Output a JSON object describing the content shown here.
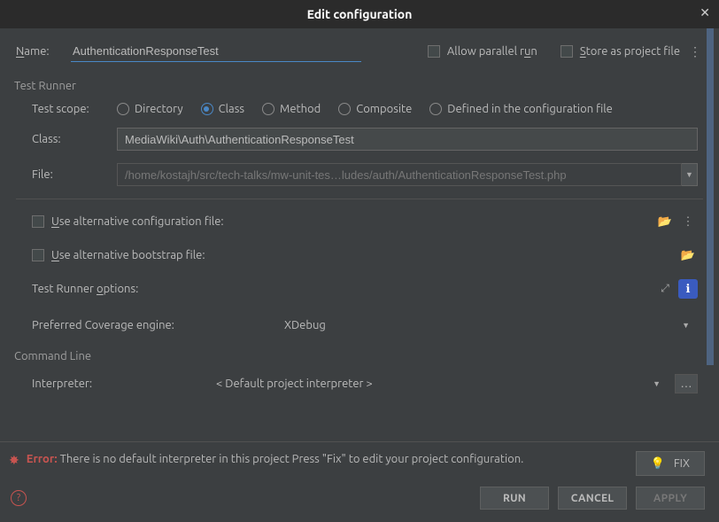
{
  "titlebar": {
    "title": "Edit conﬁguration"
  },
  "name": {
    "label": "Name:",
    "value": "AuthenticationResponseTest"
  },
  "allow_parallel": "Allow parallel run",
  "store_file": "Store as project file",
  "section_runner": "Test Runner",
  "scope": {
    "label": "Test scope:",
    "options": [
      "Directory",
      "Class",
      "Method",
      "Composite",
      "Defined in the configuration file"
    ],
    "selected": "Class"
  },
  "class": {
    "label": "Class:",
    "value": "MediaWiki\\Auth\\AuthenticationResponseTest"
  },
  "file": {
    "label": "File:",
    "value": "/home/kostajh/src/tech-talks/mw-unit-tes…ludes/auth/AuthenticationResponseTest.php"
  },
  "alt_config": "Use alternative configuration file:",
  "alt_bootstrap": "Use alternative bootstrap file:",
  "runner_options": "Test Runner options:",
  "coverage": {
    "label": "Preferred Coverage engine:",
    "value": "XDebug"
  },
  "section_cmd": "Command Line",
  "interpreter": {
    "label": "Interpreter:",
    "value": "< Default project interpreter >"
  },
  "error": {
    "label": "Error:",
    "text": "There is no default interpreter in this project Press \"Fix\" to edit your project configuration.",
    "fix": "FIX"
  },
  "buttons": {
    "run": "RUN",
    "cancel": "CANCEL",
    "apply": "APPLY"
  }
}
